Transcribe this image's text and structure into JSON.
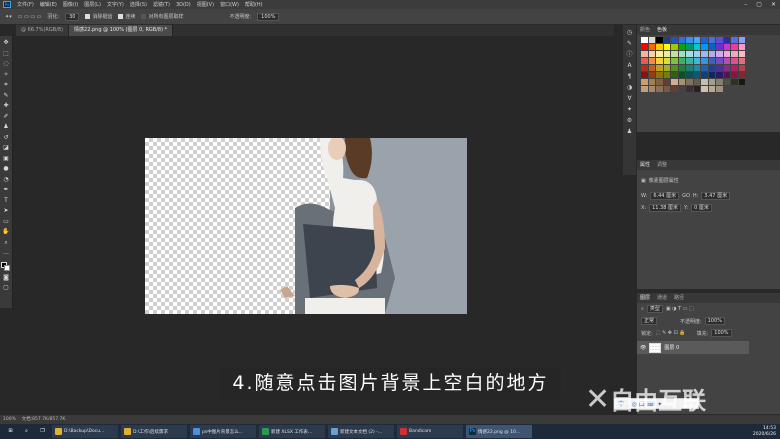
{
  "menubar": {
    "items": [
      "文件(F)",
      "编辑(E)",
      "图像(I)",
      "图层(L)",
      "文字(Y)",
      "选择(S)",
      "滤镜(T)",
      "3D(D)",
      "视图(V)",
      "窗口(W)",
      "帮助(H)"
    ],
    "logo": "Ps"
  },
  "options": {
    "feather_label": "羽化:",
    "feather_value": "30",
    "antialias_label": "消除锯齿",
    "contiguous_label": "连续",
    "sample_all_label": "对所有图层取样",
    "opacity_label": "不透明度:",
    "opacity_value": "100%"
  },
  "tabs": [
    {
      "label": "@ 66.7%(RGB/8)"
    },
    {
      "label": "情感22.png @ 100% (图层 0, RGB/8) *"
    }
  ],
  "swatches_panel": {
    "tabs": [
      "颜色",
      "色板"
    ],
    "colors": [
      "#ffffff",
      "#d9d9d9",
      "#000000",
      "#1f3f8a",
      "#2250c0",
      "#2b6fe0",
      "#3a8ff0",
      "#4aa8f5",
      "#2060d8",
      "#4a70d8",
      "#5a50d0",
      "#2d2da0",
      "#5070f0",
      "#8aa0f0",
      "#ff0000",
      "#ff6600",
      "#ffcc00",
      "#ffff00",
      "#99cc00",
      "#00aa00",
      "#009966",
      "#00cccc",
      "#0099ff",
      "#0066cc",
      "#6633cc",
      "#cc33cc",
      "#ff3399",
      "#ff99cc",
      "#f4b2a0",
      "#f9d0a0",
      "#fff0a0",
      "#e8f0a0",
      "#c0e0a0",
      "#a0e0c0",
      "#a0e0e0",
      "#a0d0f0",
      "#a0b8f0",
      "#b8a8f0",
      "#d0a8f0",
      "#f0a8e0",
      "#f0a8c0",
      "#f0c0c0",
      "#e06050",
      "#f09040",
      "#f8d040",
      "#d8e040",
      "#80c040",
      "#40b060",
      "#40b0a0",
      "#40b8d0",
      "#4090e0",
      "#4060c0",
      "#7050c0",
      "#b050b0",
      "#e05090",
      "#e07080",
      "#b03020",
      "#c06020",
      "#c0a020",
      "#a0b020",
      "#509020",
      "#208040",
      "#208070",
      "#2088a0",
      "#2060b0",
      "#204090",
      "#503090",
      "#803080",
      "#b02060",
      "#b04050",
      "#801810",
      "#904010",
      "#907010",
      "#708010",
      "#306010",
      "#105020",
      "#105050",
      "#105870",
      "#104080",
      "#102860",
      "#301860",
      "#501850",
      "#801840",
      "#802830",
      "#c8a070",
      "#a08050",
      "#806040",
      "#604030",
      "#d0b090",
      "#a89070",
      "#807060",
      "#606050",
      "#c0c0b0",
      "#a0a090",
      "#808070",
      "#505040",
      "#303020",
      "#181810"
    ],
    "sub_colors": [
      "#c0a080",
      "#a88868",
      "#907058",
      "#785848",
      "#604038",
      "#484040",
      "#383030",
      "#282020",
      "#d0c0b0",
      "#b8a898",
      "#a09080"
    ]
  },
  "properties_panel": {
    "tabs": [
      "属性",
      "调整"
    ],
    "section_label": "像素图层属性",
    "w_label": "W:",
    "w_value": "6.44 厘米",
    "go_label": "GO",
    "h_label": "H:",
    "h_value": "3.47 厘米",
    "x_label": "X:",
    "x_value": "11.38 厘米",
    "y_label": "Y:",
    "y_value": "0 厘米"
  },
  "layers_panel": {
    "tabs": [
      "图层",
      "通道",
      "路径"
    ],
    "filter_label": "类型",
    "blend_mode": "正常",
    "opacity_label": "不透明度:",
    "opacity_value": "100%",
    "lock_label": "锁定:",
    "fill_label": "填充:",
    "fill_value": "100%",
    "layer_name": "图层 0"
  },
  "status": {
    "zoom": "100%",
    "doc": "文档:857.7K/857.7K"
  },
  "subtitle": "4.随意点击图片背景上空白的地方",
  "watermark": "自由互联",
  "taskbar": {
    "apps": [
      {
        "label": "D:\\Backup\\Docu...",
        "color": "#e0b030"
      },
      {
        "label": "D:\\工作\\后续需求",
        "color": "#e0b030"
      },
      {
        "label": "ps中图片背景怎么...",
        "color": "#4a90e0"
      },
      {
        "label": "新建 XLSX 工作表...",
        "color": "#2a9a50"
      },
      {
        "label": "新建文本文档 (2) -...",
        "color": "#6aa0d0"
      },
      {
        "label": "Bandicam",
        "color": "#d03030"
      },
      {
        "label": "情感22.png @ 10...",
        "color": "#31a8ff"
      }
    ],
    "time": "14:53",
    "date": "2020/6/26"
  },
  "ime": {
    "text": "中 ·, ◎ 囗 ⌨ ✦"
  }
}
